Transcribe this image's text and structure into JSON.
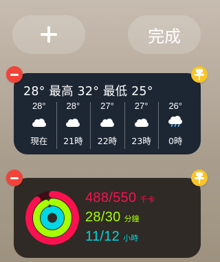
{
  "toolbar": {
    "add_icon": "plus-icon",
    "done_label": "完成"
  },
  "weather": {
    "summary": "28°  最高 32° 最低 25°",
    "hours": [
      {
        "temp": "28°",
        "icon": "cloud-icon",
        "label": "現在"
      },
      {
        "temp": "28°",
        "icon": "cloud-icon",
        "label": "21時"
      },
      {
        "temp": "27°",
        "icon": "cloud-icon",
        "label": "22時"
      },
      {
        "temp": "27°",
        "icon": "cloud-icon",
        "label": "23時"
      },
      {
        "temp": "26°",
        "icon": "cloud-rain-icon",
        "label": "0時"
      }
    ]
  },
  "activity": {
    "move": {
      "value": "488/550",
      "unit": "千卡",
      "progress": 0.887,
      "color": "#fa114f"
    },
    "exercise": {
      "value": "28/30",
      "unit": "分鐘",
      "progress": 0.933,
      "color": "#a6ff00"
    },
    "stand": {
      "value": "11/12",
      "unit": "小時",
      "progress": 0.917,
      "color": "#00d7e4"
    }
  },
  "badges": {
    "remove_color": "#f2433a",
    "pin_color": "#f7c42a"
  }
}
